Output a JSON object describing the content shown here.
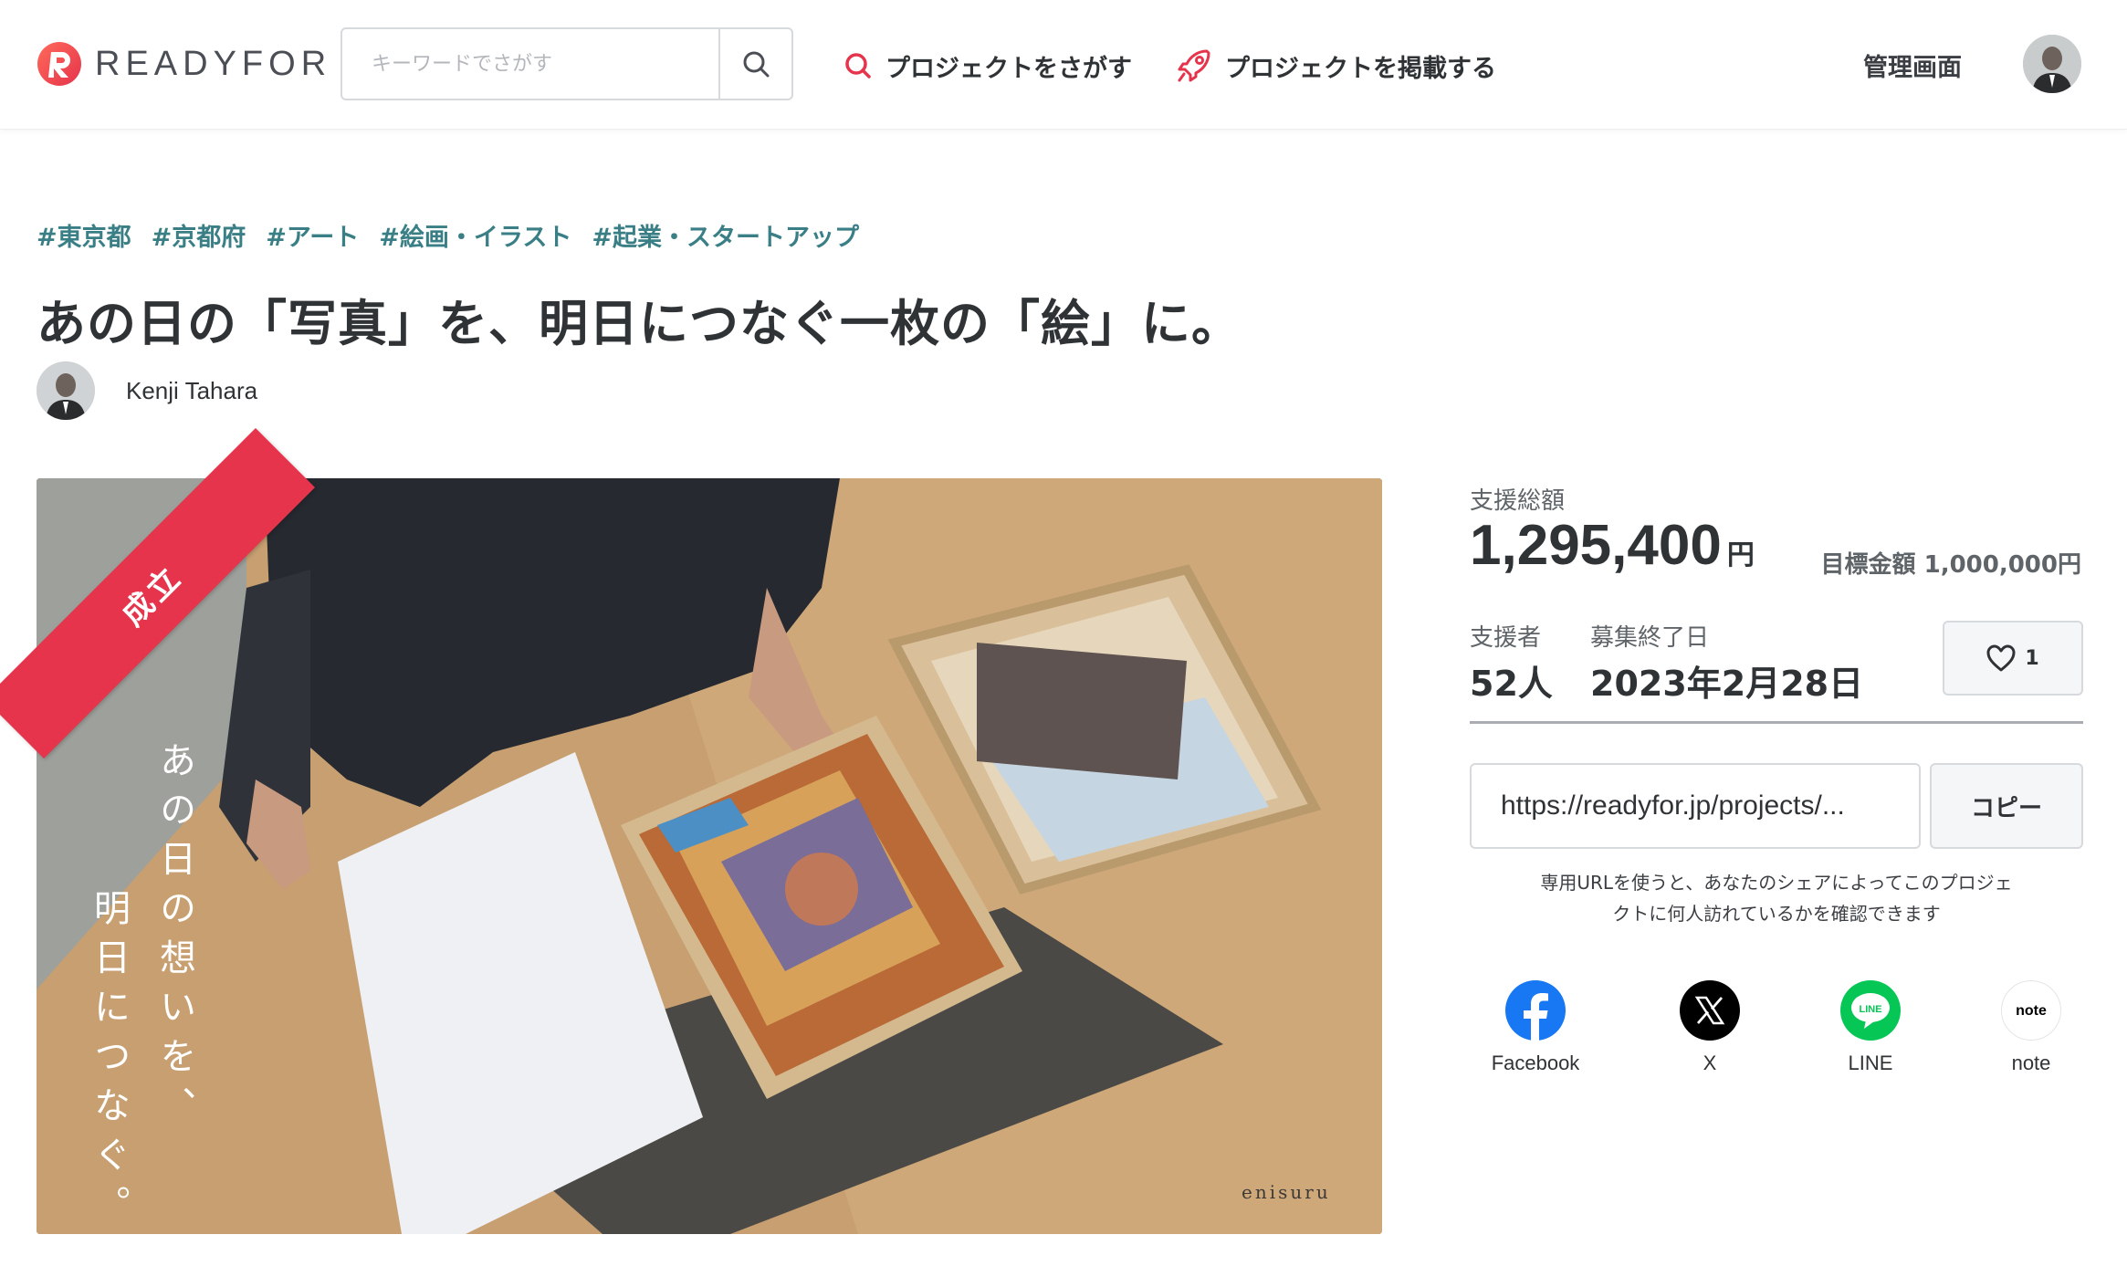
{
  "header": {
    "logo_text": "READYFOR",
    "search_placeholder": "キーワードでさがす",
    "nav_find": "プロジェクトをさがす",
    "nav_post": "プロジェクトを掲載する",
    "admin": "管理画面"
  },
  "project": {
    "tags": [
      "#東京都",
      "#京都府",
      "#アート",
      "#絵画・イラスト",
      "#起業・スタートアップ"
    ],
    "title": "あの日の「写真」を、明日につなぐ一枚の「絵」に。",
    "owner_name": "Kenji Tahara",
    "status_ribbon": "成立",
    "hero_text_line1": "あの日の想いを、",
    "hero_text_line2": "明日につなぐ。",
    "hero_brand": "enisuru"
  },
  "stats": {
    "total_label": "支援総額",
    "total_amount": "1,295,400",
    "total_unit": "円",
    "goal": "目標金額 1,000,000円",
    "supporters_label": "支援者",
    "supporters_value": "52人",
    "end_label": "募集終了日",
    "end_value": "2023年2月28日",
    "favorite_count": "1"
  },
  "share": {
    "url": "https://readyfor.jp/projects/...",
    "copy_label": "コピー",
    "note_line1": "専用URLを使うと、あなたのシェアによってこのプロジェ",
    "note_line2": "クトに何人訪れているかを確認できます",
    "services": [
      {
        "label": "Facebook",
        "icon": "facebook-icon",
        "color": "#1877f2"
      },
      {
        "label": "X",
        "icon": "x-icon",
        "color": "#000000"
      },
      {
        "label": "LINE",
        "icon": "line-icon",
        "color": "#06c755"
      },
      {
        "label": "note",
        "icon": "note-icon",
        "color": "#ffffff"
      }
    ]
  },
  "colors": {
    "brand_red": "#e5344c",
    "tag_teal": "#3a7f86",
    "text_dark": "#2f3336"
  }
}
